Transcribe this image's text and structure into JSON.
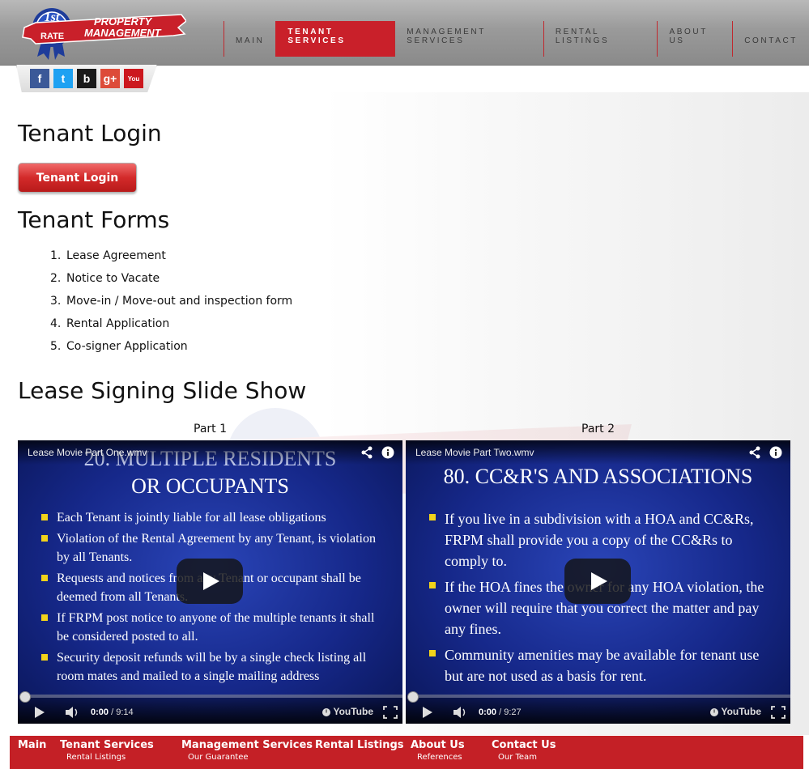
{
  "header": {
    "logo": {
      "line1": "1st",
      "line2": "RATE",
      "line3": "PROPERTY",
      "line4": "MANAGEMENT"
    },
    "nav": [
      {
        "label": "MAIN",
        "active": false
      },
      {
        "label": "TENANT SERVICES",
        "active": true
      },
      {
        "label": "MANAGEMENT SERVICES",
        "active": false
      },
      {
        "label": "RENTAL LISTINGS",
        "active": false
      },
      {
        "label": "ABOUT US",
        "active": false
      },
      {
        "label": "CONTACT",
        "active": false
      }
    ],
    "social": [
      {
        "name": "facebook-icon",
        "glyph": "f",
        "color": "#3b5998"
      },
      {
        "name": "twitter-icon",
        "glyph": "t",
        "color": "#1da1f2"
      },
      {
        "name": "blog-icon",
        "glyph": "b",
        "color": "#1a1a1a"
      },
      {
        "name": "google-plus-icon",
        "glyph": "g+",
        "color": "#dd4b39"
      },
      {
        "name": "youtube-icon",
        "glyph": "You",
        "color": "#cc181e"
      }
    ]
  },
  "main": {
    "login_heading": "Tenant Login",
    "login_button": "Tenant Login",
    "forms_heading": "Tenant Forms",
    "forms": [
      {
        "num": "1.",
        "label": "Lease Agreement"
      },
      {
        "num": "2.",
        "label": "Notice to Vacate"
      },
      {
        "num": "3.",
        "label": "Move-in / Move-out and inspection form"
      },
      {
        "num": "4.",
        "label": "Rental Application"
      },
      {
        "num": "5.",
        "label": "Co-signer Application"
      }
    ],
    "slideshow_heading": "Lease Signing Slide Show",
    "videos": [
      {
        "part": "Part 1",
        "title": "Lease Movie Part One.wmv",
        "slide_heading_1": "20. MULTIPLE RESIDENTS",
        "slide_heading_2": "OR OCCUPANTS",
        "bullets": [
          "Each Tenant is jointly liable for all lease obligations",
          "Violation of the Rental Agreement by any Tenant, is violation by all Tenants.",
          "Requests and notices from any Tenant or occupant shall be deemed from all Tenants.",
          "If FRPM post notice to anyone of the multiple tenants it shall be considered posted to all.",
          "Security deposit refunds will be by a single check listing all room mates and mailed to a single mailing address"
        ],
        "time_current": "0:00",
        "time_total": "/ 9:14"
      },
      {
        "part": "Part 2",
        "title": "Lease Movie Part Two.wmv",
        "slide_heading_1": "80. CC&R'S AND ASSOCIATIONS",
        "slide_heading_2": "",
        "bullets": [
          "If you live in a subdivision with a HOA and CC&Rs, FRPM shall provide you a copy of the CC&Rs to comply to.",
          "If the HOA fines the owner for any HOA violation, the owner will require that you correct the matter and pay any fines.",
          "Community amenities may be available for tenant use but are not used as a basis for rent."
        ],
        "time_current": "0:00",
        "time_total": "/ 9:27"
      }
    ],
    "youtube_label": "YouTube"
  },
  "footer": {
    "columns": [
      {
        "main": "Main",
        "sub": ""
      },
      {
        "main": "Tenant Services",
        "sub": "Rental Listings"
      },
      {
        "main": "Management Services",
        "sub": "Our Guarantee"
      },
      {
        "main": "Rental Listings",
        "sub": ""
      },
      {
        "main": "About Us",
        "sub": "References"
      },
      {
        "main": "Contact Us",
        "sub": "Our Team"
      }
    ]
  },
  "colors": {
    "brand_red": "#c9202a",
    "slide_blue": "#16288a",
    "bullet_yellow": "#f2d31a"
  }
}
